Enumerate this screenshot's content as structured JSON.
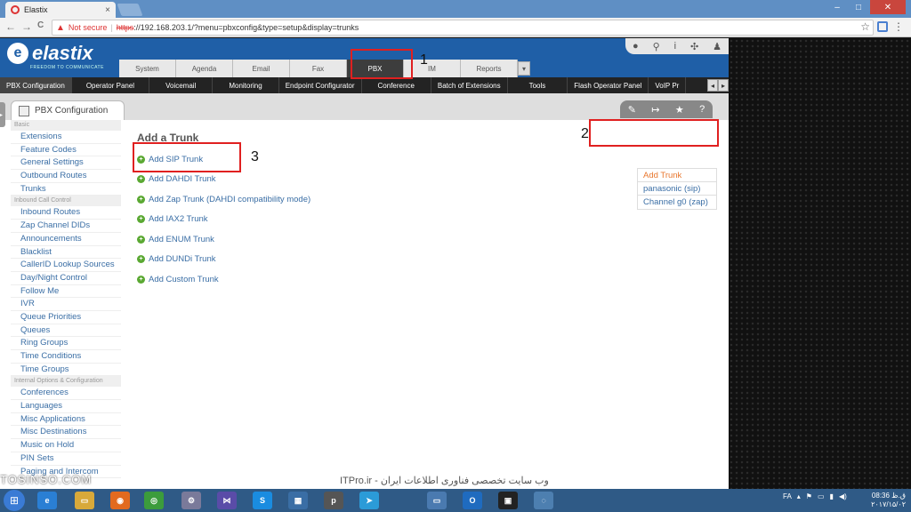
{
  "browser": {
    "tab_title": "Elastix",
    "tab_close": "×",
    "window_min": "–",
    "window_max": "□",
    "window_close": "✕",
    "back": "←",
    "forward": "→",
    "reload": "C",
    "not_secure": "Not secure",
    "url_scheme": "https",
    "url_rest": "://192.168.203.1/?menu=pbxconfig&type=setup&display=trunks",
    "star": "☆",
    "menu": "⋮"
  },
  "header": {
    "logo_mark": "e",
    "logo_text": "elastix",
    "tagline": "FREEDOM TO COMMUNICATE",
    "top_icons": [
      "●",
      "⚲",
      "i",
      "✣",
      "♟"
    ],
    "main_tabs": [
      "System",
      "Agenda",
      "Email",
      "Fax",
      "PBX",
      "IM",
      "Reports"
    ],
    "active_tab": "PBX",
    "tab_arrow": "▾"
  },
  "submenu": {
    "items": [
      "PBX Configuration",
      "Operator Panel",
      "Voicemail",
      "Monitoring",
      "Endpoint Configurator",
      "Conference",
      "Batch of Extensions",
      "Tools",
      "Flash Operator Panel",
      "VoIP Pr"
    ],
    "active": "PBX Configuration",
    "arrow_left": "◂",
    "arrow_right": "▸"
  },
  "pagetab": {
    "label": "PBX Configuration",
    "tools": [
      "✎",
      "↦",
      "★",
      "?"
    ]
  },
  "sidebar": {
    "groups": [
      {
        "title": "Basic",
        "items": [
          "Extensions",
          "Feature Codes",
          "General Settings",
          "Outbound Routes",
          "Trunks"
        ]
      },
      {
        "title": "Inbound Call Control",
        "items": [
          "Inbound Routes",
          "Zap Channel DIDs",
          "Announcements",
          "Blacklist",
          "CallerID Lookup Sources",
          "Day/Night Control",
          "Follow Me",
          "IVR",
          "Queue Priorities",
          "Queues",
          "Ring Groups",
          "Time Conditions",
          "Time Groups"
        ]
      },
      {
        "title": "Internal Options & Configuration",
        "items": [
          "Conferences",
          "Languages",
          "Misc Applications",
          "Misc Destinations",
          "Music on Hold",
          "PIN Sets",
          "Paging and Intercom"
        ]
      }
    ]
  },
  "main": {
    "heading": "Add a Trunk",
    "links": [
      "Add SIP Trunk",
      "Add DAHDI Trunk",
      "Add Zap Trunk (DAHDI compatibility mode)",
      "Add IAX2 Trunk",
      "Add ENUM Trunk",
      "Add DUNDi Trunk",
      "Add Custom Trunk"
    ],
    "plus": "+"
  },
  "trunk_list": [
    "Add Trunk",
    "panasonic (sip)",
    "Channel g0 (zap)"
  ],
  "callouts": [
    "1",
    "2",
    "3"
  ],
  "watermark": {
    "left": "TOSINSO.COM",
    "right": "ITPro.ir - وب سایت تخصصی فناوری اطلاعات ایران"
  },
  "taskbar": {
    "start": "⊞",
    "apps": [
      "e",
      "▭",
      "◉",
      "◎",
      "⚙",
      "⋈",
      "S",
      "▦",
      "p",
      "➤",
      "▭",
      "O",
      "▣",
      "◌"
    ],
    "app_colors": [
      "#2a7fd4",
      "#d8a93a",
      "#e26a1f",
      "#3c9c3c",
      "#7a7a9a",
      "#5a4ca8",
      "#1a8ce0",
      "#3a6ea5",
      "#555555",
      "#2b9bd8",
      "#4a7ab0",
      "#1f6bbf",
      "#222222",
      "#4d7fb0"
    ],
    "lang": "FA",
    "time": "08:36 ق.ظ",
    "date": "۲۰۱۷/۱۵/۰۲"
  }
}
